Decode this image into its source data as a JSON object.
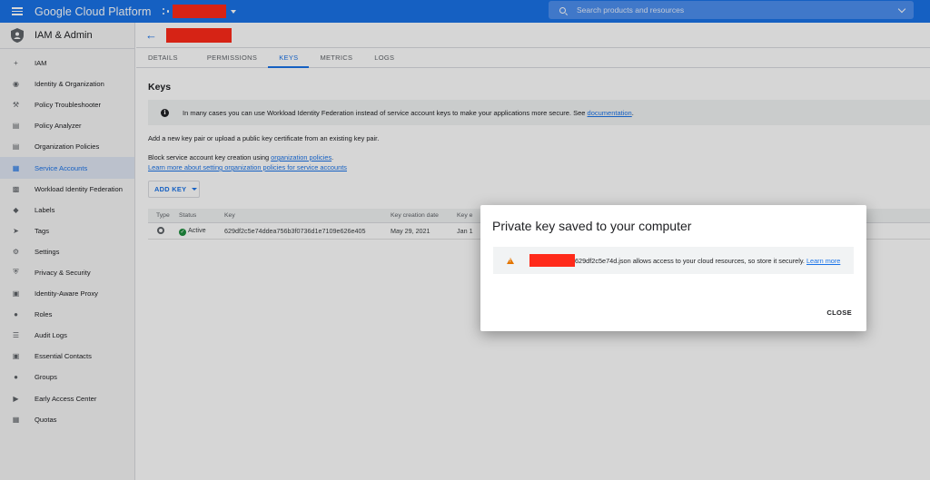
{
  "topbar": {
    "brand": "Google Cloud Platform",
    "search_placeholder": "Search products and resources"
  },
  "sidebar": {
    "title": "IAM & Admin",
    "items": [
      {
        "label": "IAM",
        "icon": "person-add-icon"
      },
      {
        "label": "Identity & Organization",
        "icon": "account-circle-icon"
      },
      {
        "label": "Policy Troubleshooter",
        "icon": "wrench-icon"
      },
      {
        "label": "Policy Analyzer",
        "icon": "document-search-icon"
      },
      {
        "label": "Organization Policies",
        "icon": "list-icon"
      },
      {
        "label": "Service Accounts",
        "icon": "service-account-icon",
        "active": true
      },
      {
        "label": "Workload Identity Federation",
        "icon": "federation-icon"
      },
      {
        "label": "Labels",
        "icon": "tag-icon"
      },
      {
        "label": "Tags",
        "icon": "chevron-tag-icon"
      },
      {
        "label": "Settings",
        "icon": "gear-icon"
      },
      {
        "label": "Privacy & Security",
        "icon": "shield-icon"
      },
      {
        "label": "Identity-Aware Proxy",
        "icon": "proxy-icon"
      },
      {
        "label": "Roles",
        "icon": "roles-icon"
      },
      {
        "label": "Audit Logs",
        "icon": "list-lines-icon"
      },
      {
        "label": "Essential Contacts",
        "icon": "contact-card-icon"
      },
      {
        "label": "Groups",
        "icon": "groups-icon"
      },
      {
        "label": "Early Access Center",
        "icon": "megaphone-icon"
      },
      {
        "label": "Quotas",
        "icon": "table-icon"
      }
    ]
  },
  "tabs": [
    {
      "label": "DETAILS"
    },
    {
      "label": "PERMISSIONS"
    },
    {
      "label": "KEYS",
      "active": true
    },
    {
      "label": "METRICS"
    },
    {
      "label": "LOGS"
    }
  ],
  "keys": {
    "title": "Keys",
    "banner_text": "In many cases you can use Workload Identity Federation instead of service account keys to make your applications more secure. See",
    "banner_link": "documentation",
    "banner_after": ".",
    "add_text": "Add a new key pair or upload a public key certificate from an existing key pair.",
    "block_text": "Block service account key creation using",
    "block_link": "organization policies",
    "block_after": ".",
    "learn_link": "Learn more about setting organization policies for service accounts",
    "add_key_label": "ADD KEY"
  },
  "table": {
    "headers": [
      "Type",
      "Status",
      "Key",
      "Key creation date",
      "Key e"
    ],
    "rows": [
      {
        "status": "Active",
        "key": "629df2c5e74ddea756b3f0736d1e7109e626e405",
        "created": "May 29, 2021",
        "expires": "Jan 1"
      }
    ]
  },
  "dialog": {
    "title": "Private key saved to your computer",
    "message": "629df2c5e74d.json allows access to your cloud resources, so store it securely.",
    "learn_more": "Learn more",
    "close_label": "CLOSE"
  },
  "colors": {
    "accent": "#1a73e8",
    "redaction": "#ff2a1a",
    "warning": "#e37400",
    "active_status": "#1e8e3e"
  }
}
